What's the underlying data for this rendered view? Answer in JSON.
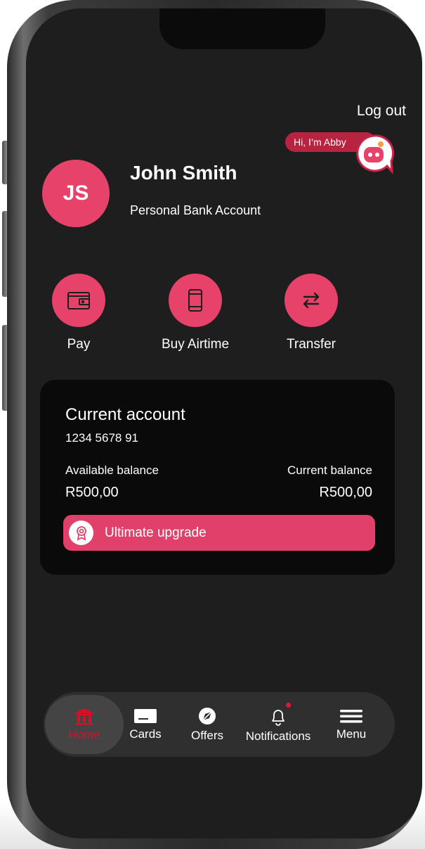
{
  "header": {
    "logout_label": "Log out",
    "chat_bubble": "Hi, I’m Abby"
  },
  "user": {
    "initials": "JS",
    "name": "John Smith",
    "account_type": "Personal Bank Account"
  },
  "actions": [
    {
      "label": "Pay",
      "icon": "wallet-icon"
    },
    {
      "label": "Buy Airtime",
      "icon": "phone-icon"
    },
    {
      "label": "Transfer",
      "icon": "transfer-icon"
    }
  ],
  "account_card": {
    "title": "Current account",
    "number": "1234 5678 91",
    "available_label": "Available balance",
    "available_value": "R500,00",
    "current_label": "Current balance",
    "current_value": "R500,00",
    "upgrade_label": "Ultimate upgrade",
    "upgrade_icon": "award-icon"
  },
  "tabs": [
    {
      "label": "Home",
      "icon": "bank-icon",
      "active": true
    },
    {
      "label": "Cards",
      "icon": "card-icon"
    },
    {
      "label": "Offers",
      "icon": "compass-icon"
    },
    {
      "label": "Notifications",
      "icon": "bell-icon",
      "has_dot": true
    },
    {
      "label": "Menu",
      "icon": "hamburger-icon"
    }
  ],
  "colors": {
    "accent": "#e6426a",
    "chat_bubble": "#b8233f",
    "active_tab": "#d8102a",
    "screen_bg": "#1e1e1e",
    "card_bg": "#0a0a0a"
  }
}
